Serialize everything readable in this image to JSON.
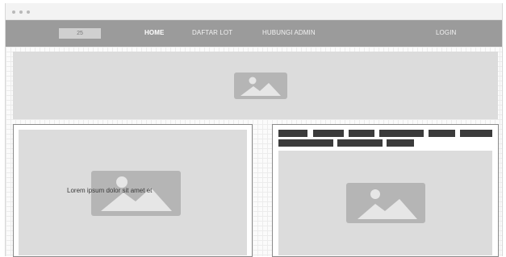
{
  "window": {
    "controls": [
      "close",
      "minimize",
      "maximize"
    ]
  },
  "navbar": {
    "logo_text": "25",
    "links": [
      {
        "label": "HOME",
        "active": true
      },
      {
        "label": "DAFTAR LOT",
        "active": false
      },
      {
        "label": "HUBUNGI ADMIN",
        "active": false
      }
    ],
    "login_label": "LOGIN"
  },
  "banner": {
    "icon": "image-placeholder-icon"
  },
  "left_card": {
    "text": "Lorem ipsum dolor sit amet et",
    "icon": "image-placeholder-icon"
  },
  "right_card": {
    "icon": "image-placeholder-icon",
    "redacted_bar_rows": 2,
    "redacted_bar_count": 9
  },
  "colors": {
    "navbar": "#9b9b9b",
    "placeholder": "#dcdcdc",
    "icon_fill": "#b5b5b5",
    "bar_fill": "#3b3b3b"
  }
}
